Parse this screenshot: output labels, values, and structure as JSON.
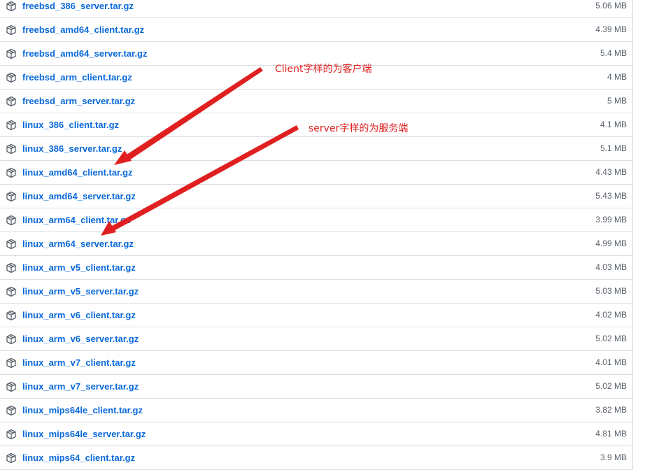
{
  "assets": [
    {
      "name": "freebsd_386_server.tar.gz",
      "size": "5.06 MB"
    },
    {
      "name": "freebsd_amd64_client.tar.gz",
      "size": "4.39 MB"
    },
    {
      "name": "freebsd_amd64_server.tar.gz",
      "size": "5.4 MB"
    },
    {
      "name": "freebsd_arm_client.tar.gz",
      "size": "4 MB"
    },
    {
      "name": "freebsd_arm_server.tar.gz",
      "size": "5 MB"
    },
    {
      "name": "linux_386_client.tar.gz",
      "size": "4.1 MB"
    },
    {
      "name": "linux_386_server.tar.gz",
      "size": "5.1 MB"
    },
    {
      "name": "linux_amd64_client.tar.gz",
      "size": "4.43 MB"
    },
    {
      "name": "linux_amd64_server.tar.gz",
      "size": "5.43 MB"
    },
    {
      "name": "linux_arm64_client.tar.gz",
      "size": "3.99 MB"
    },
    {
      "name": "linux_arm64_server.tar.gz",
      "size": "4.99 MB"
    },
    {
      "name": "linux_arm_v5_client.tar.gz",
      "size": "4.03 MB"
    },
    {
      "name": "linux_arm_v5_server.tar.gz",
      "size": "5.03 MB"
    },
    {
      "name": "linux_arm_v6_client.tar.gz",
      "size": "4.02 MB"
    },
    {
      "name": "linux_arm_v6_server.tar.gz",
      "size": "5.02 MB"
    },
    {
      "name": "linux_arm_v7_client.tar.gz",
      "size": "4.01 MB"
    },
    {
      "name": "linux_arm_v7_server.tar.gz",
      "size": "5.02 MB"
    },
    {
      "name": "linux_mips64le_client.tar.gz",
      "size": "3.82 MB"
    },
    {
      "name": "linux_mips64le_server.tar.gz",
      "size": "4.81 MB"
    },
    {
      "name": "linux_mips64_client.tar.gz",
      "size": "3.9 MB"
    }
  ],
  "icon": "package-icon",
  "colors": {
    "link": "#0969da",
    "size": "#57606a",
    "border": "#d8dee4",
    "annotation": "#e02020"
  },
  "annotations": {
    "client_note": "Client字样的为客户端",
    "server_note": "server字样的为服务端"
  }
}
